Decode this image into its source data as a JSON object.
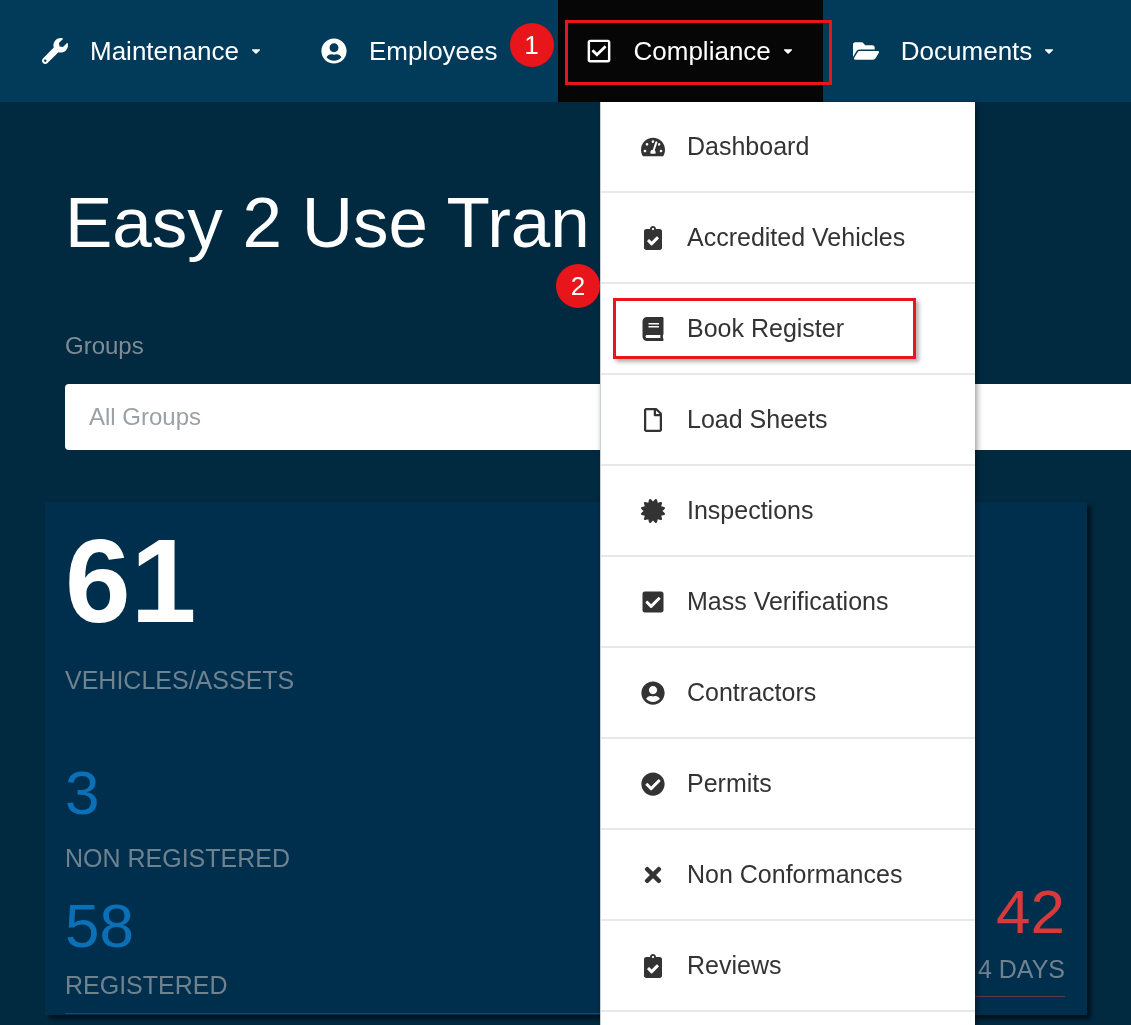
{
  "navbar": {
    "items": [
      {
        "label": "Maintenance",
        "dropdown": true,
        "selected": false
      },
      {
        "label": "Employees",
        "dropdown": false,
        "selected": false
      },
      {
        "label": "Compliance",
        "dropdown": true,
        "selected": true
      },
      {
        "label": "Documents",
        "dropdown": true,
        "selected": false
      }
    ]
  },
  "page": {
    "title": "Easy 2 Use Tran",
    "groups_label": "Groups",
    "groups_field": {
      "placeholder": "All Groups"
    }
  },
  "stats": {
    "total": "61",
    "total_label": "VEHICLES/ASSETS",
    "non_registered": "3",
    "non_registered_label": "NON REGISTERED",
    "registered": "58",
    "registered_label": "REGISTERED",
    "right_value": "42",
    "right_label": "4 DAYS"
  },
  "menu": {
    "items": [
      {
        "label": "Dashboard"
      },
      {
        "label": "Accredited Vehicles"
      },
      {
        "label": "Book Register"
      },
      {
        "label": "Load Sheets"
      },
      {
        "label": "Inspections"
      },
      {
        "label": "Mass Verifications"
      },
      {
        "label": "Contractors"
      },
      {
        "label": "Permits"
      },
      {
        "label": "Non Conformances"
      },
      {
        "label": "Reviews"
      }
    ]
  },
  "annotations": [
    {
      "number": "1"
    },
    {
      "number": "2"
    }
  ]
}
